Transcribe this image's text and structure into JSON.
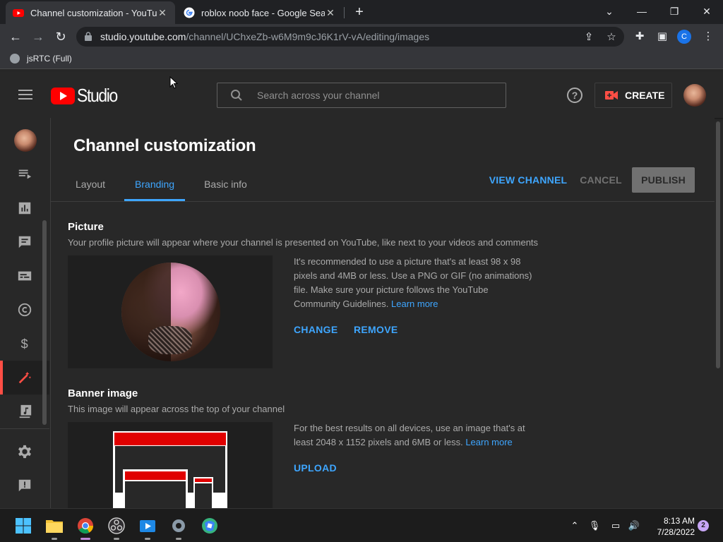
{
  "browser": {
    "tabs": [
      {
        "title": "Channel customization - YouTube Studio",
        "favicon": "youtube-icon",
        "active": true
      },
      {
        "title": "roblox noob face - Google Search",
        "favicon": "google-icon",
        "active": false
      }
    ],
    "url_host": "studio.youtube.com",
    "url_path": "/channel/UChxeZb-w6M9m9cJ6K1rV-vA/editing/images",
    "profile_letter": "C",
    "bookmark": "jsRTC (Full)"
  },
  "studio": {
    "search_placeholder": "Search across your channel",
    "create_label": "CREATE",
    "help_label": "?",
    "page_title": "Channel customization",
    "tabs": [
      "Layout",
      "Branding",
      "Basic info"
    ],
    "active_tab": "Branding",
    "view_channel": "VIEW CHANNEL",
    "cancel": "CANCEL",
    "publish": "PUBLISH",
    "picture": {
      "title": "Picture",
      "desc": "Your profile picture will appear where your channel is presented on YouTube, like next to your videos and comments",
      "info": "It's recommended to use a picture that's at least 98 x 98 pixels and 4MB or less. Use a PNG or GIF (no animations) file. Make sure your picture follows the YouTube Community Guidelines.",
      "learn_more": "Learn more",
      "change": "CHANGE",
      "remove": "REMOVE"
    },
    "banner": {
      "title": "Banner image",
      "desc": "This image will appear across the top of your channel",
      "info": "For the best results on all devices, use an image that's at least 2048 x 1152 pixels and 6MB or less.",
      "learn_more": "Learn more",
      "upload": "UPLOAD"
    },
    "sidebar_icons": [
      "dashboard-icon",
      "content-icon",
      "analytics-icon",
      "comments-icon",
      "subtitles-icon",
      "copyright-icon",
      "earn-icon",
      "customization-icon",
      "audio-library-icon",
      "settings-icon",
      "feedback-icon"
    ],
    "active_sidebar": "customization-icon"
  },
  "taskbar": {
    "time": "8:13 AM",
    "date": "7/28/2022",
    "notifications": "2",
    "apps": [
      "windows-start-icon",
      "file-explorer-icon",
      "chrome-icon",
      "obs-icon",
      "video-editor-icon",
      "settings-icon",
      "roblox-studio-icon"
    ]
  },
  "colors": {
    "accent_blue": "#3ea6ff",
    "youtube_red": "#ff0000",
    "active_red": "#ff4e45",
    "background": "#282828"
  }
}
